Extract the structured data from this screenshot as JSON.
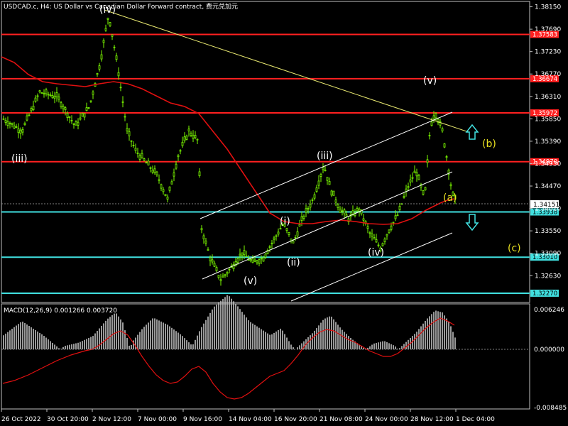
{
  "header": {
    "title": "USDCAD.c, H4:  US Dollar vs Canadian Dollar Forward contract, 费元兑加元"
  },
  "chart_data": [
    {
      "type": "candlestick",
      "symbol": "USDCAD.c",
      "timeframe": "H4",
      "ylim": [
        1.3208,
        1.3826
      ],
      "y_ticks": [
        "1.38150",
        "1.37690",
        "1.37230",
        "1.36770",
        "1.36310",
        "1.35850",
        "1.35390",
        "1.34930",
        "1.34470",
        "1.34010",
        "1.33550",
        "1.33090",
        "1.32630"
      ],
      "x_ticks": [
        "26 Oct 2022",
        "30 Oct 20:00",
        "2 Nov 12:00",
        "7 Nov 00:00",
        "9 Nov 16:00",
        "14 Nov 04:00",
        "16 Nov 20:00",
        "21 Nov 08:00",
        "24 Nov 00:00",
        "28 Nov 12:00",
        "1 Dec 04:00"
      ],
      "current_price": "1.34151",
      "horizontal_levels": [
        {
          "price": 1.37583,
          "label": "1.37583",
          "color": "#ff2020",
          "label_bg": "#ff2020"
        },
        {
          "price": 1.36674,
          "label": "1.36674",
          "color": "#ff2020",
          "label_bg": "#ff2020"
        },
        {
          "price": 1.35972,
          "label": "1.35972",
          "color": "#ff2020",
          "label_bg": "#ff2020"
        },
        {
          "price": 1.3497,
          "label": "1.34970",
          "color": "#ff2020",
          "label_bg": "#ff2020"
        },
        {
          "price": 1.33938,
          "label": "1.33938",
          "color": "#40e0e0",
          "label_bg": "#40e0e0"
        },
        {
          "price": 1.3301,
          "label": "1.33010",
          "color": "#40e0e0",
          "label_bg": "#40e0e0"
        },
        {
          "price": 1.3227,
          "label": "1.32270",
          "color": "#40e0e0",
          "label_bg": "#40e0e0"
        }
      ],
      "partial_tick_label": "1.34010",
      "wave_labels": [
        {
          "text": "(iv)",
          "color": "#ffffff"
        },
        {
          "text": "(iii)",
          "color": "#ffffff"
        },
        {
          "text": "(v)",
          "color": "#ffffff"
        },
        {
          "text": "(i)",
          "color": "#ffffff"
        },
        {
          "text": "(ii)",
          "color": "#ffffff"
        },
        {
          "text": "(iii)",
          "color": "#ffffff"
        },
        {
          "text": "(iv)",
          "color": "#ffffff"
        },
        {
          "text": "(v)",
          "color": "#ffffff"
        },
        {
          "text": "(b)",
          "color": "#e8e020"
        },
        {
          "text": "(c)",
          "color": "#e8e020"
        },
        {
          "text": "(a)",
          "color": "#e8e020"
        }
      ],
      "arrows": [
        {
          "direction": "up",
          "color": "#40e0e0"
        },
        {
          "direction": "down",
          "color": "#40e0e0"
        }
      ],
      "colors": {
        "candle": "#7cfc00",
        "moving_average": "#e01010",
        "trendline": "#e8e870",
        "channel": "#ffffff"
      }
    },
    {
      "type": "histogram",
      "title": "MACD(12,26,9) 0.001266 0.003720",
      "y_ticks": [
        "0.006246",
        "0.000000",
        "-0.008485"
      ],
      "colors": {
        "histogram": "#c0c0c0",
        "signal": "#e01010"
      }
    }
  ]
}
